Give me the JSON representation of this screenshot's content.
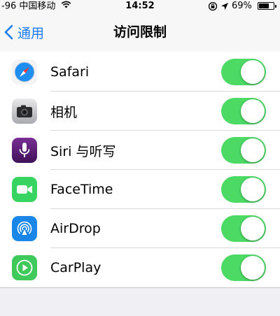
{
  "status_bar": {
    "signal": "-96",
    "carrier": "中国移动",
    "time": "14:52",
    "battery_text": "69%",
    "battery_level": 0.69
  },
  "nav": {
    "back_label": "通用",
    "title": "访问限制"
  },
  "colors": {
    "accent": "#1a7bf2",
    "toggle_on": "#4cd964"
  },
  "items": [
    {
      "label": "Safari",
      "icon": "safari-icon",
      "enabled": true
    },
    {
      "label": "相机",
      "icon": "camera-icon",
      "enabled": true
    },
    {
      "label": "Siri 与听写",
      "icon": "siri-microphone-icon",
      "enabled": true
    },
    {
      "label": "FaceTime",
      "icon": "facetime-video-icon",
      "enabled": true
    },
    {
      "label": "AirDrop",
      "icon": "airdrop-icon",
      "enabled": true
    },
    {
      "label": "CarPlay",
      "icon": "carplay-icon",
      "enabled": true
    }
  ]
}
